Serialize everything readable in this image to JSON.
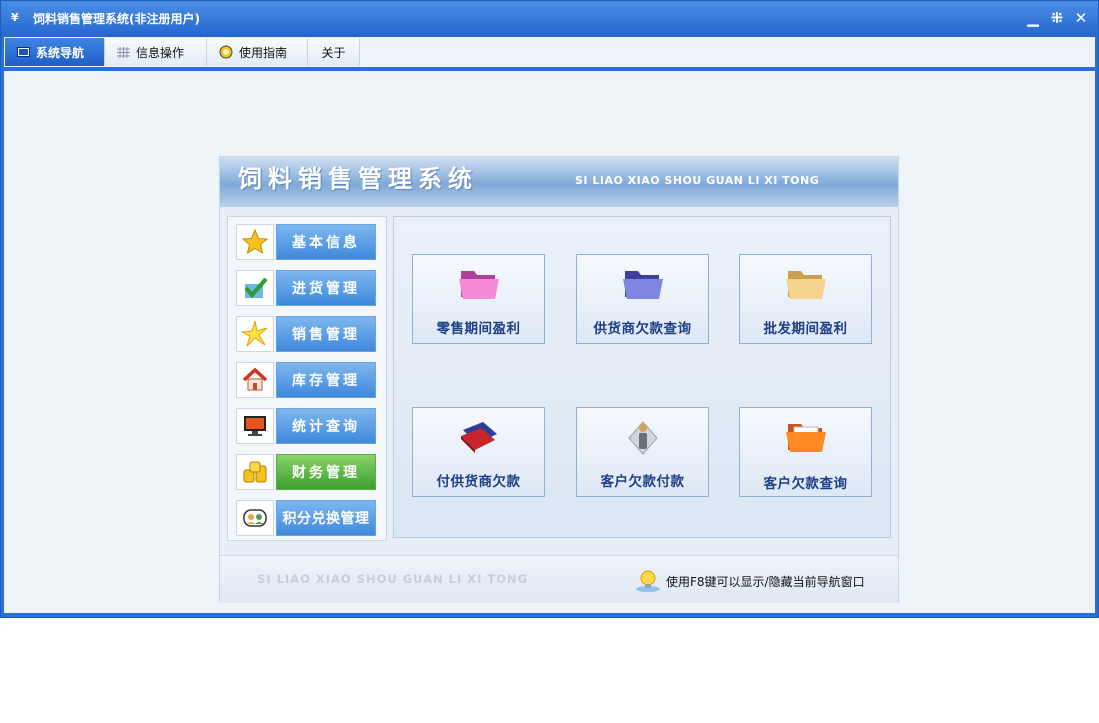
{
  "window": {
    "title": "饲料销售管理系统(非注册用户)",
    "icon_glyph": "¥"
  },
  "menu": {
    "items": [
      {
        "label": "系统导航",
        "icon": "monitor-icon"
      },
      {
        "label": "信息操作",
        "icon": "grid-icon"
      },
      {
        "label": "使用指南",
        "icon": "help-circle-icon"
      },
      {
        "label": "关于",
        "icon": ""
      }
    ]
  },
  "panel": {
    "title": "饲料销售管理系统",
    "subtitle": "SI LIAO XIAO SHOU GUAN LI XI TONG"
  },
  "sidebar": {
    "items": [
      {
        "label": "基本信息",
        "icon": "star-icon"
      },
      {
        "label": "进货管理",
        "icon": "check-icon"
      },
      {
        "label": "销售管理",
        "icon": "sparkle-icon"
      },
      {
        "label": "库存管理",
        "icon": "house-icon"
      },
      {
        "label": "统计查询",
        "icon": "monitor-icon"
      },
      {
        "label": "财务管理",
        "icon": "coins-icon"
      },
      {
        "label": "积分兑换管理",
        "icon": "people-icon"
      }
    ]
  },
  "cards": [
    {
      "label": "零售期间盈利",
      "icon": "folder-pink-icon"
    },
    {
      "label": "供货商欠款查询",
      "icon": "folder-purple-icon"
    },
    {
      "label": "批发期间盈利",
      "icon": "folder-yellow-icon"
    },
    {
      "label": "付供货商欠款",
      "icon": "books-icon"
    },
    {
      "label": "客户欠款付款",
      "icon": "person-icon"
    },
    {
      "label": "客户欠款查询",
      "icon": "folder-orange-icon"
    }
  ],
  "footer": {
    "brand": "SI LIAO XIAO SHOU GUAN LI XI TONG",
    "tip": "使用F8键可以显示/隐藏当前导航窗口"
  },
  "colors": {
    "titlebar": "#2466cc",
    "menu_active": "#1f5fc6",
    "sidebar_button": "#3e88dc",
    "sidebar_active": "#3e9e2c",
    "card_text": "#1d3f86"
  }
}
